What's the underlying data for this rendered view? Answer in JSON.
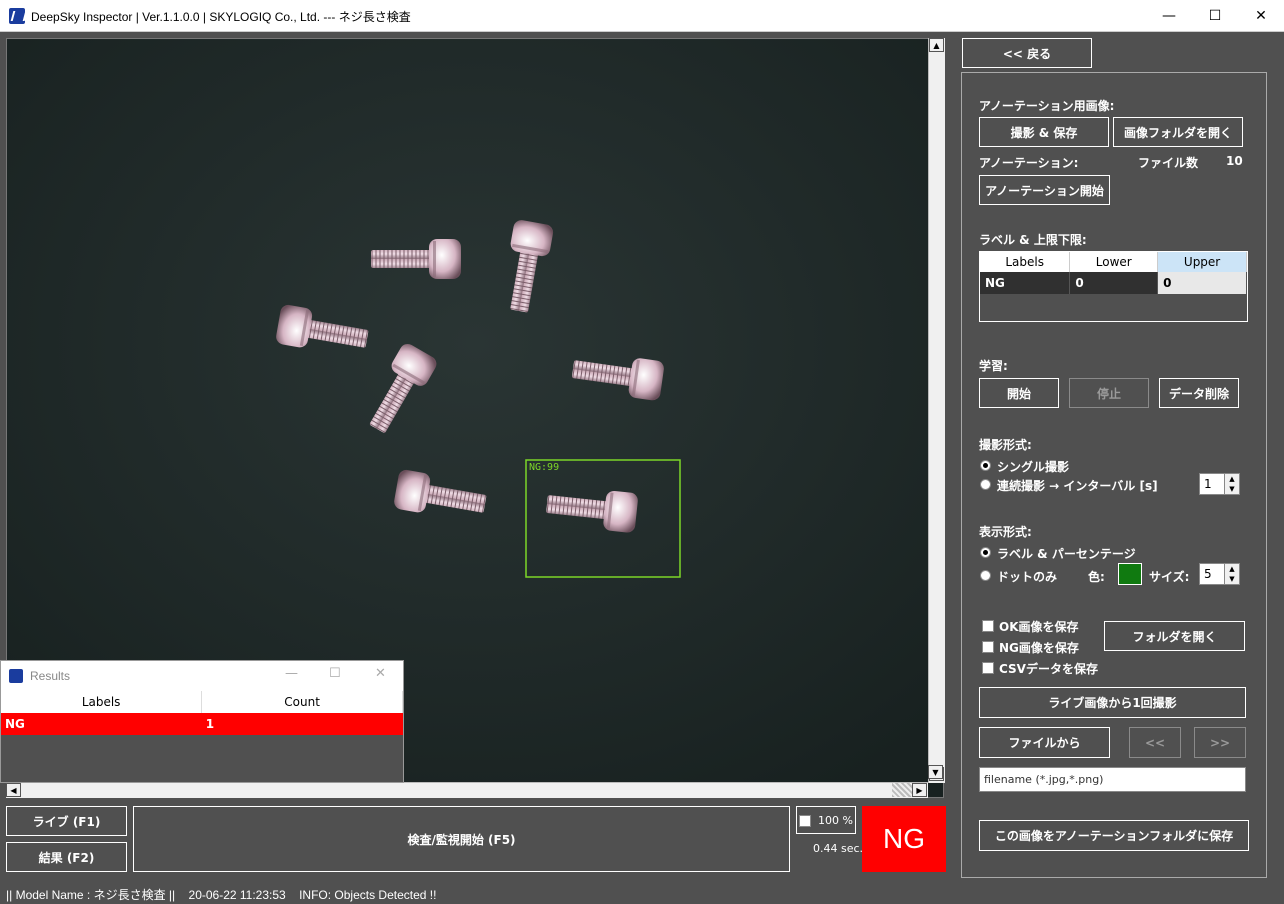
{
  "window": {
    "title": "DeepSky Inspector | Ver.1.1.0.0 | SKYLOGIQ Co., Ltd. --- ネジ長さ検査",
    "minimize": "—",
    "maximize": "☐",
    "close": "✕"
  },
  "canvas": {
    "detection_label": "NG:99",
    "detection_color": "#7cd628",
    "background_color": "#1f2a2a"
  },
  "results_window": {
    "title": "Results",
    "minimize": "—",
    "maximize": "☐",
    "close": "✕",
    "columns": [
      "Labels",
      "Count"
    ],
    "rows": [
      {
        "label": "NG",
        "count": "1"
      }
    ]
  },
  "bottom_bar": {
    "live_button": "ライブ (F1)",
    "result_button": "結果 (F2)",
    "inspect_button": "検査/監視開始 (F5)",
    "zoom_label": "100 %",
    "time_label": "0.44 sec.",
    "verdict": "NG",
    "verdict_color": "#ff0000"
  },
  "right_panel": {
    "back_button": "<< 戻る",
    "annotation_image_heading": "アノーテーション用画像:",
    "capture_save_button": "撮影 & 保存",
    "open_image_folder_button": "画像フォルダを開く",
    "annotation_heading": "アノーテーション:",
    "file_count_label": "ファイル数",
    "file_count_value": "10",
    "annotation_start_button": "アノーテーション開始",
    "label_limits_heading": "ラベル & 上限下限:",
    "label_table": {
      "columns": [
        "Labels",
        "Lower",
        "Upper"
      ],
      "rows": [
        {
          "label": "NG",
          "lower": "0",
          "upper": "0"
        }
      ]
    },
    "learning_heading": "学習:",
    "start_button": "開始",
    "stop_button": "停止",
    "delete_data_button": "データ削除",
    "capture_mode_heading": "撮影形式:",
    "single_capture": "シングル撮影",
    "continuous_capture": "連続撮影 → インターバル [s]",
    "interval_value": "1",
    "display_mode_heading": "表示形式:",
    "label_percentage": "ラベル & パーセンテージ",
    "dots_only": "ドットのみ",
    "color_label": "色:",
    "dot_color": "#107a10",
    "size_label": "サイズ:",
    "size_value": "5",
    "save_ok_label": "OK画像を保存",
    "save_ng_label": "NG画像を保存",
    "save_csv_label": "CSVデータを保存",
    "open_folder_button": "フォルダを開く",
    "capture_once_button": "ライブ画像から1回撮影",
    "from_file_button": "ファイルから",
    "prev_button": "<<",
    "next_button": ">>",
    "filename_placeholder": "filename (*.jpg,*.png)",
    "save_to_annotation_button": "この画像をアノーテーションフォルダに保存"
  },
  "status_bar": {
    "model": "|| Model Name : ネジ長さ検査 ||",
    "datetime": "20-06-22 11:23:53",
    "info": "INFO:   Objects Detected !!"
  }
}
